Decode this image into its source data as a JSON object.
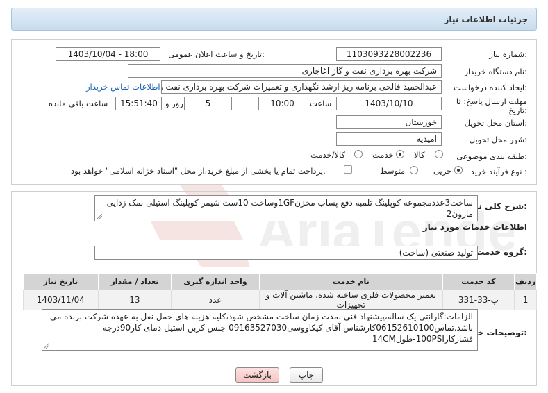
{
  "header": {
    "title": "جزئیات اطلاعات نیاز"
  },
  "form": {
    "need_number_label": "شماره نیاز:",
    "need_number": "1103093228002236",
    "announce_label": "تاریخ و ساعت اعلان عمومی:",
    "announce_value": "1403/10/04 - 18:00",
    "buyer_org_label": "نام دستگاه خریدار:",
    "buyer_org": "شرکت بهره برداری نفت و گاز اغاجاری",
    "creator_label": "ایجاد کننده درخواست:",
    "creator": "عبدالحمید فالحی برنامه ریز ارشد نگهداری و تعمیرات شرکت بهره برداری نفت و",
    "contact_link": "اطلاعات تماس خریدار",
    "deadline_label_1": "مهلت ارسال پاسخ: تا",
    "deadline_label_2": "تاریخ:",
    "deadline_date": "1403/10/10",
    "time_label": "ساعت",
    "deadline_time": "10:00",
    "days_value": "5",
    "days_label": "روز و",
    "remaining_value": "15:51:40",
    "remaining_label": "ساعت باقی مانده",
    "province_label": "استان محل تحویل:",
    "province": "خوزستان",
    "city_label": "شهر محل تحویل:",
    "city": "امیدیه",
    "category_label": "طبقه بندی موضوعی:",
    "category_options": [
      "کالا",
      "خدمت",
      "کالا/خدمت"
    ],
    "process_label": "نوع فرآیند خرید :",
    "process_options": [
      "جزیی",
      "متوسط"
    ],
    "payment_note": "پرداخت تمام یا بخشی از مبلغ خرید،از محل \"اسناد خزانه اسلامی\" خواهد بود."
  },
  "description": {
    "label": "شرح کلی نیاز:",
    "text": "ساخت3عددمجموعه کوپلینگ تلمبه دفع پساب مخزن1GFوساخت 10ست شیمز کوپلینگ استیلی نمک زدایی مارون2"
  },
  "services": {
    "section_title": "اطلاعات خدمات مورد نیاز",
    "group_label": "گروه خدمت:",
    "group_value": "تولید صنعتی (ساخت)",
    "columns": [
      "ردیف",
      "کد خدمت",
      "نام خدمت",
      "واحد اندازه گیری",
      "تعداد / مقدار",
      "تاریخ نیاز"
    ],
    "rows": [
      [
        "1",
        "پ-33-331",
        "تعمیر محصولات فلزی ساخته شده، ماشین آلات و تجهیزات",
        "عدد",
        "13",
        "1403/11/04"
      ]
    ]
  },
  "buyer_notes": {
    "label": "توضیحات خریدار:",
    "text": "الزامات:گارانتی یک ساله،پیشنهاد فنی ،مدت زمان ساخت مشخص شود،کلیه هزینه های حمل نقل به عهده شرکت برنده می باشد.تماس06152610100کارشناس آقای کیکاووسی09163527030-جنس کربن استیل-دمای کار90درجه-فشارکار100PSI-طول14CM"
  },
  "actions": {
    "print": "چاپ",
    "back": "بازگشت"
  },
  "watermark": {
    "text": "AriaTender.neT"
  },
  "colors": {
    "link": "#1a5fb4",
    "header_bg": "#d6e6f4",
    "back_button": "#fbd0d0",
    "watermark": "#c0392b"
  }
}
